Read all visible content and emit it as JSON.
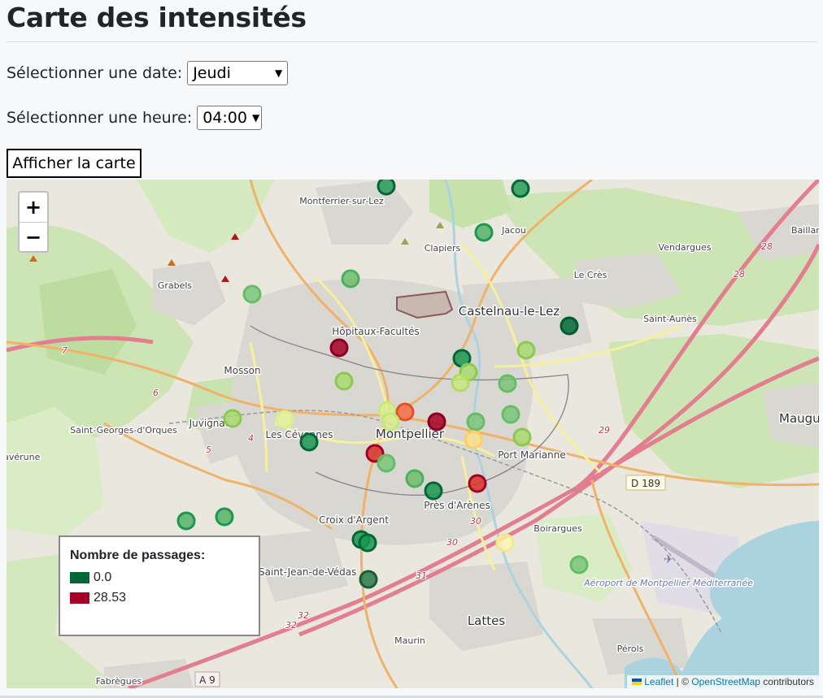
{
  "page": {
    "title": "Carte des intensités"
  },
  "controls": {
    "date_label": "Sélectionner une date:",
    "date_value": "Jeudi",
    "hour_label": "Sélectionner une heure:",
    "hour_value": "04:00",
    "show_button": "Afficher la carte"
  },
  "map": {
    "zoom_in": "+",
    "zoom_out": "−",
    "place_labels": [
      "Montferrier-sur-Lez",
      "Jacou",
      "Clapiers",
      "Baillargues",
      "Vendargues",
      "Le Crès",
      "Grabels",
      "Castelnau-le-Lez",
      "Saint-Aunès",
      "Hôpitaux-Facultés",
      "Mosson",
      "Saint-Georges-d'Orques",
      "Juvignac",
      "Les Cévennes",
      "Montpellier",
      "Port Marianne",
      "Mauguio",
      "Lavérune",
      "Saint-Jean-de-Védas",
      "Croix d'Argent",
      "Près d'Arènes",
      "Boirargues",
      "Lattes",
      "Maurin",
      "Pérols",
      "Fabrègues",
      "Aéroport de Montpellier Méditerranée"
    ],
    "road_refs": [
      "7",
      "6",
      "5",
      "4",
      "28",
      "28",
      "29",
      "30",
      "30",
      "31",
      "32",
      "32",
      "D 189",
      "A 9"
    ],
    "marker_scale": {
      "min_color": "#006837",
      "max_color": "#a50026"
    },
    "legend": {
      "title": "Nombre de passages:",
      "entries": [
        {
          "label": "0.0",
          "color": "#006837"
        },
        {
          "label": "28.53",
          "color": "#a50026"
        }
      ]
    },
    "attribution": {
      "leaflet": "Leaflet",
      "separator": " | © ",
      "osm": "OpenStreetMap",
      "suffix": " contributors"
    }
  }
}
